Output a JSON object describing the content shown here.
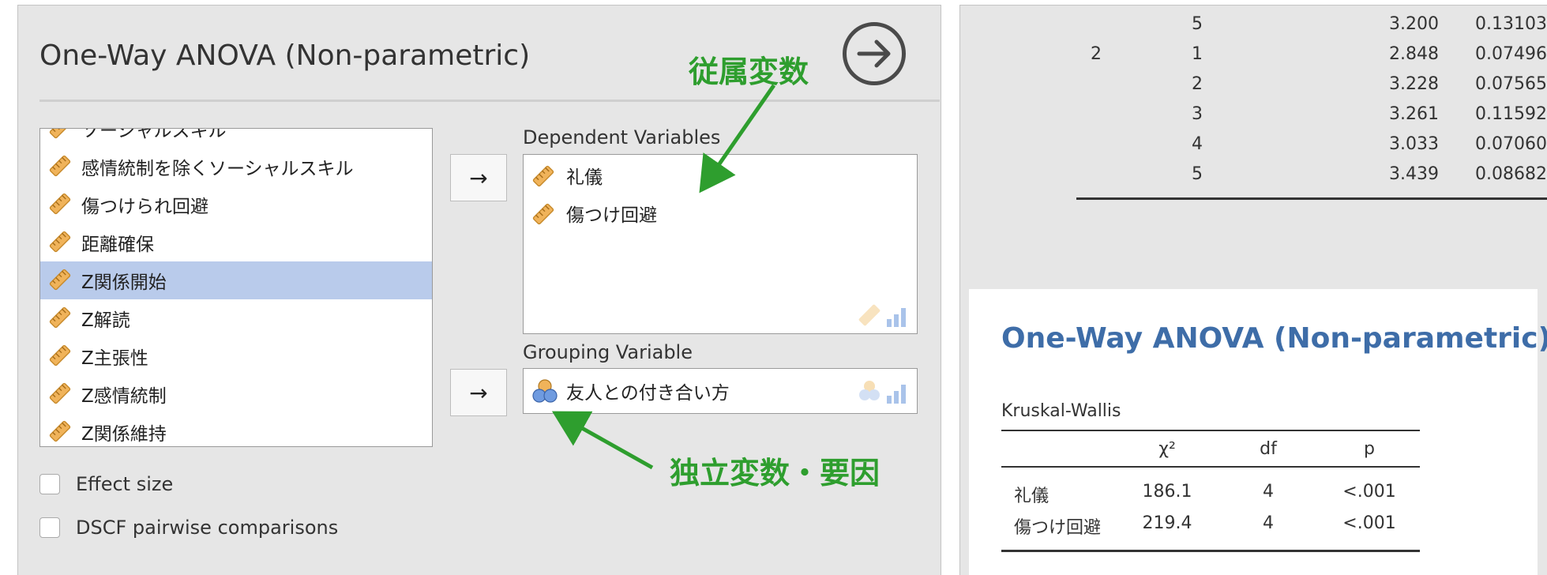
{
  "options": {
    "title": "One-Way ANOVA (Non-parametric)",
    "variables": [
      {
        "label": "ソーシャルスキル",
        "selected": false
      },
      {
        "label": "感情統制を除くソーシャルスキル",
        "selected": false
      },
      {
        "label": "傷つけられ回避",
        "selected": false
      },
      {
        "label": "距離確保",
        "selected": false
      },
      {
        "label": "Z関係開始",
        "selected": true
      },
      {
        "label": "Z解読",
        "selected": false
      },
      {
        "label": "Z主張性",
        "selected": false
      },
      {
        "label": "Z感情統制",
        "selected": false
      },
      {
        "label": "Z関係維持",
        "selected": false
      }
    ],
    "move_arrow": "→",
    "dependent_title": "Dependent Variables",
    "dependent_vars": [
      "礼儀",
      "傷つけ回避"
    ],
    "grouping_title": "Grouping Variable",
    "grouping_var": "友人との付き合い方",
    "checkboxes": [
      {
        "label": "Effect size",
        "checked": false
      },
      {
        "label": "DSCF pairwise comparisons",
        "checked": false
      }
    ]
  },
  "annotations": {
    "dependent_note": "従属変数",
    "independent_note": "独立変数・要因",
    "color": "#2e9e2e"
  },
  "descriptives_tail": {
    "rows": [
      {
        "group": "",
        "level": "5",
        "mean": "3.200",
        "se": "0.13103"
      },
      {
        "group": "2",
        "level": "1",
        "mean": "2.848",
        "se": "0.07496"
      },
      {
        "group": "",
        "level": "2",
        "mean": "3.228",
        "se": "0.07565"
      },
      {
        "group": "",
        "level": "3",
        "mean": "3.261",
        "se": "0.11592"
      },
      {
        "group": "",
        "level": "4",
        "mean": "3.033",
        "se": "0.07060"
      },
      {
        "group": "",
        "level": "5",
        "mean": "3.439",
        "se": "0.08682"
      }
    ]
  },
  "results": {
    "title": "One-Way ANOVA (Non-parametric)",
    "subtitle": "Kruskal-Wallis",
    "headers": [
      "",
      "χ²",
      "df",
      "p"
    ],
    "rows": [
      [
        "礼儀",
        "186.1",
        "4",
        "<.001"
      ],
      [
        "傷つけ回避",
        "219.4",
        "4",
        "<.001"
      ]
    ],
    "title_color": "#3e6da8"
  }
}
